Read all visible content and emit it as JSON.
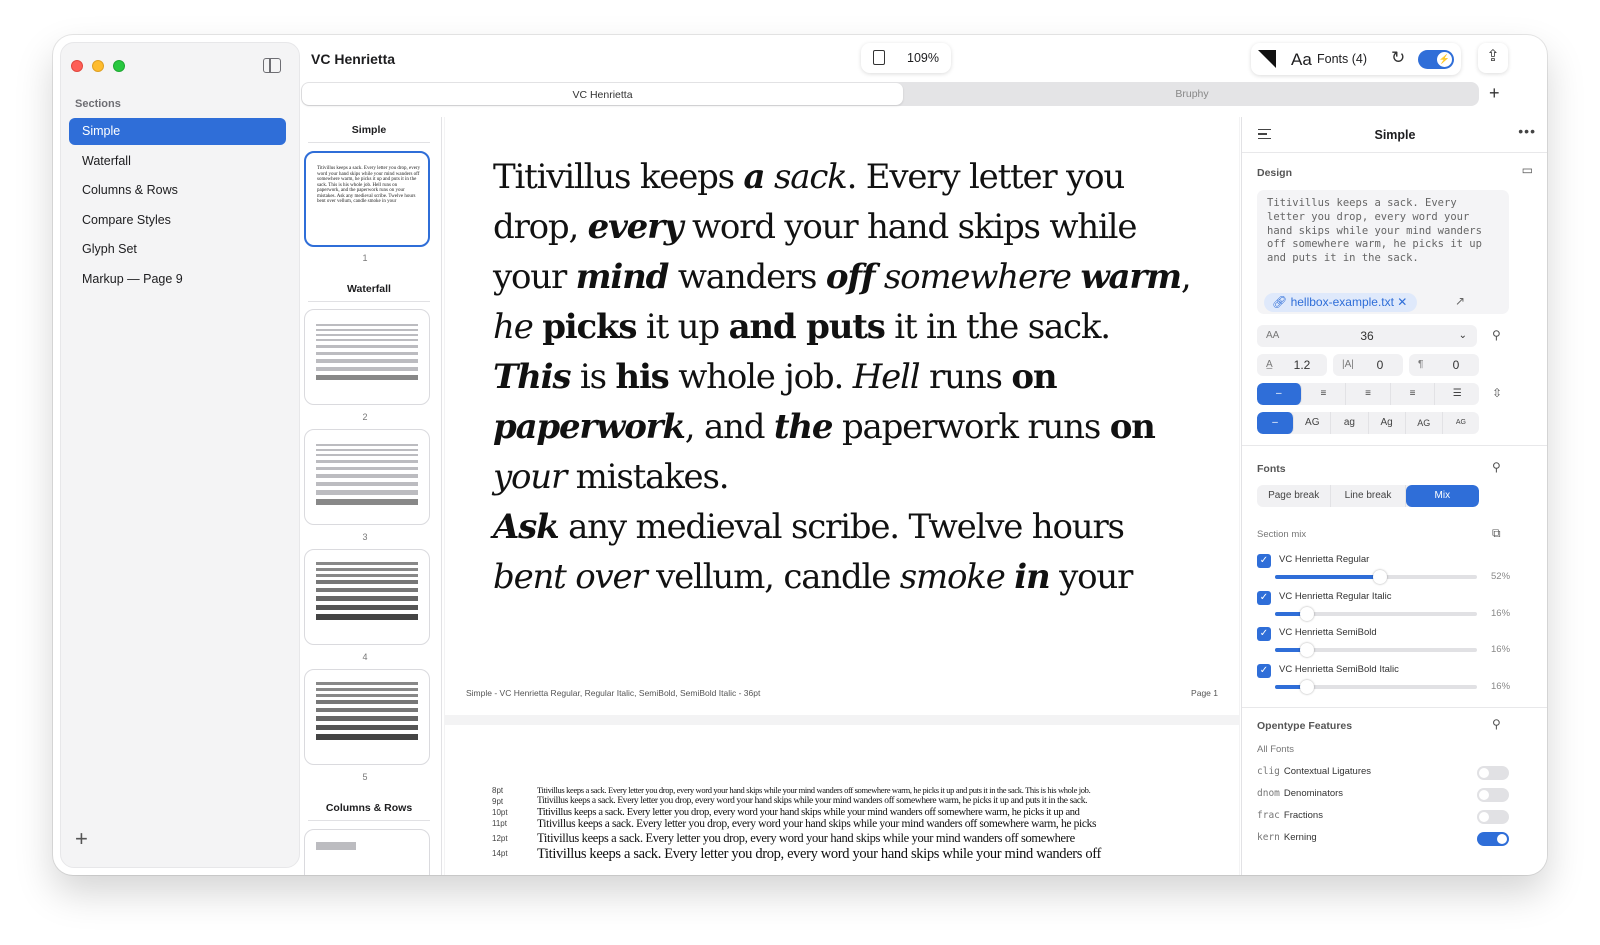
{
  "window": {
    "title": "VC Henrietta",
    "zoom": "109%"
  },
  "toolbar": {
    "aa": "Aa",
    "fonts_label": "Fonts (4)"
  },
  "sidebar": {
    "heading": "Sections",
    "items": [
      "Simple",
      "Waterfall",
      "Columns & Rows",
      "Compare Styles",
      "Glyph Set",
      "Markup — Page 9"
    ],
    "active_index": 0
  },
  "tabs": [
    {
      "label": "VC Henrietta",
      "active": true
    },
    {
      "label": "Bruphy",
      "active": false
    }
  ],
  "thumbnails": {
    "groups": [
      "Simple",
      "Waterfall",
      "Columns & Rows"
    ],
    "page_numbers": [
      "1",
      "2",
      "3",
      "4",
      "5"
    ],
    "preview_text": "Titivillus keeps a sack. Every letter you drop, every word your hand skips while your mind wanders off somewhere warm, he picks it up and puts it in the sack. This is his whole job. Hell runs on paperwork, and the paperwork runs on your mistakes. Ask any medieval scribe. Twelve hours bent over vellum, candle smoke in your"
  },
  "page1": {
    "footer": "Simple - VC Henrietta Regular, Regular Italic, SemiBold, SemiBold Italic - 36pt",
    "page_label": "Page 1",
    "runs": [
      [
        "r",
        "Titivillus keeps "
      ],
      [
        "bi",
        "a"
      ],
      [
        "i",
        " sack"
      ],
      [
        "r",
        ". Every letter you drop, "
      ],
      [
        "bi",
        "every"
      ],
      [
        "r",
        " word your hand skips while your "
      ],
      [
        "bi",
        "mind"
      ],
      [
        "r",
        " wanders "
      ],
      [
        "bi",
        "off"
      ],
      [
        "i",
        " somewhere "
      ],
      [
        "bi",
        "warm"
      ],
      [
        "r",
        ", "
      ],
      [
        "i",
        "he "
      ],
      [
        "b",
        "picks"
      ],
      [
        "r",
        " it up "
      ],
      [
        "b",
        "and puts"
      ],
      [
        "r",
        " it in the sack. "
      ],
      [
        "bi",
        "This"
      ],
      [
        "r",
        " is "
      ],
      [
        "b",
        "his"
      ],
      [
        "r",
        " whole job. "
      ],
      [
        "i",
        "Hell"
      ],
      [
        "r",
        " runs "
      ],
      [
        "b",
        "on "
      ],
      [
        "bi",
        "paperwork"
      ],
      [
        "r",
        ", and "
      ],
      [
        "bi",
        "the"
      ],
      [
        "r",
        " paperwork runs "
      ],
      [
        "b",
        "on "
      ],
      [
        "i",
        "your"
      ],
      [
        "r",
        " mistakes."
      ],
      [
        "br",
        ""
      ],
      [
        "bi",
        "Ask"
      ],
      [
        "r",
        " any medieval scribe. Twelve hours "
      ],
      [
        "i",
        "bent over"
      ],
      [
        "r",
        " vellum, candle "
      ],
      [
        "i",
        "smoke "
      ],
      [
        "bi",
        "in"
      ],
      [
        "r",
        " your"
      ]
    ]
  },
  "waterfall": {
    "sizes": [
      "8pt",
      "9pt",
      "10pt",
      "11pt",
      "12pt",
      "14pt"
    ],
    "lines": [
      "Titivillus keeps a sack. Every letter you drop, every word your hand skips while your mind wanders off somewhere warm, he picks it up and puts it in the sack. This is his whole job.",
      "Titivillus keeps a sack. Every letter you drop, every word your hand skips while your mind wanders off somewhere warm, he picks it up and puts it in the sack.",
      "Titivillus keeps a sack. Every letter you drop, every word your hand skips while your mind wanders off somewhere warm, he picks it up and",
      "Titivillus keeps a sack. Every letter you drop, every word your hand skips while your mind wanders off somewhere warm, he picks",
      "Titivillus keeps a sack. Every letter you drop, every word your hand skips while your mind wanders off somewhere",
      "Titivillus keeps a sack. Every letter you drop, every word your hand skips while your mind wanders off"
    ]
  },
  "inspector": {
    "title": "Simple",
    "design_label": "Design",
    "sample_text": "Titivillus keeps a sack. Every letter you drop, every word your hand skips while your mind wanders off somewhere warm, he picks it up and puts it in the sack.",
    "file_chip": "hellbox-example.txt",
    "size_icon": "AA",
    "size_value": "36",
    "line_height": "1.2",
    "tracking": "0",
    "paragraph": "0",
    "align_options": [
      "–",
      "left",
      "center",
      "right",
      "justify"
    ],
    "case_options": [
      "–",
      "AG",
      "ag",
      "Ag",
      "AG",
      "AG"
    ],
    "fonts_label": "Fonts",
    "fonts_modes": [
      "Page break",
      "Line break",
      "Mix"
    ],
    "fonts_mode_active": 2,
    "section_mix_label": "Section mix",
    "mix": [
      {
        "name": "VC Henrietta Regular",
        "pct": "52%",
        "value": 52
      },
      {
        "name": "VC Henrietta Regular Italic",
        "pct": "16%",
        "value": 16
      },
      {
        "name": "VC Henrietta SemiBold",
        "pct": "16%",
        "value": 16
      },
      {
        "name": "VC Henrietta SemiBold Italic",
        "pct": "16%",
        "value": 16
      }
    ],
    "opentype_label": "Opentype Features",
    "all_fonts_label": "All Fonts",
    "features": [
      {
        "tag": "clig",
        "name": "Contextual Ligatures",
        "on": false
      },
      {
        "tag": "dnom",
        "name": "Denominators",
        "on": false
      },
      {
        "tag": "frac",
        "name": "Fractions",
        "on": false
      },
      {
        "tag": "kern",
        "name": "Kerning",
        "on": true
      }
    ]
  },
  "colors": {
    "accent": "#2f6ed8"
  }
}
